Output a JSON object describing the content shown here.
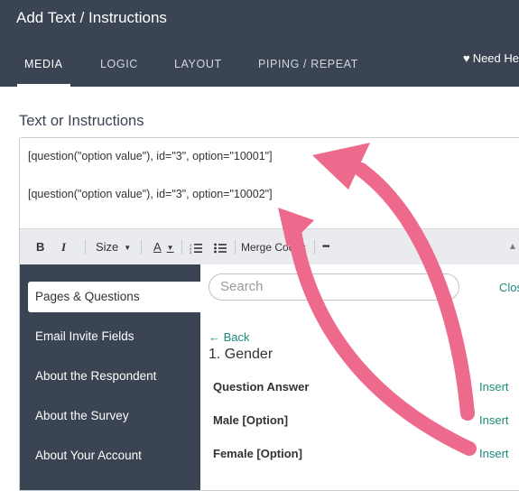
{
  "header": {
    "title": "Add Text / Instructions",
    "tabs": [
      "MEDIA",
      "LOGIC",
      "LAYOUT",
      "PIPING / REPEAT"
    ],
    "help_label": "Need He"
  },
  "section": {
    "label": "Text or Instructions"
  },
  "editor": {
    "lines": [
      "[question(\"option value\"), id=\"3\", option=\"10001\"]",
      "[question(\"option value\"), id=\"3\", option=\"10002\"]"
    ]
  },
  "toolbar": {
    "bold": "B",
    "italic": "I",
    "size": "Size",
    "font_color": "A",
    "merge": "Merge Codes",
    "more": "•••"
  },
  "panel": {
    "sidebar": [
      "Pages & Questions",
      "Email Invite Fields",
      "About the Respondent",
      "About the Survey",
      "About Your Account"
    ],
    "search_placeholder": "Search",
    "close_label": "Clos",
    "back_label": "← Back",
    "question_title": "1. Gender",
    "options": [
      {
        "label": "Question Answer",
        "action": "Insert"
      },
      {
        "label": "Male [Option]",
        "action": "Insert"
      },
      {
        "label": "Female [Option]",
        "action": "Insert"
      }
    ]
  },
  "colors": {
    "header_bg": "#3a4452",
    "link": "#1b8a7c",
    "arrow": "#ee6a8d"
  }
}
